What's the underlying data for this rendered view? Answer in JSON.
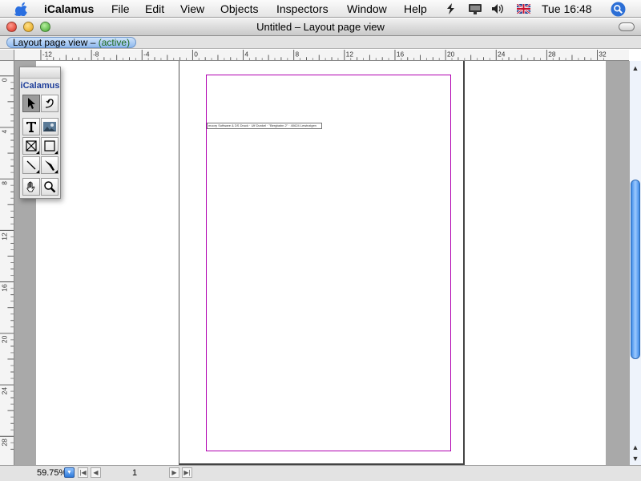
{
  "menubar": {
    "app_name": "iCalamus",
    "items": [
      "File",
      "Edit",
      "View",
      "Objects",
      "Inspectors",
      "Window",
      "Help"
    ],
    "clock": "Tue 16:48",
    "icons": [
      "apple-icon",
      "script-icon",
      "display-icon",
      "volume-icon",
      "uk-flag-icon",
      "spotlight-icon"
    ]
  },
  "window": {
    "title": "Untitled – Layout page view",
    "tab_label": "Layout page view –",
    "tab_status": "(active)"
  },
  "rulers": {
    "horizontal": [
      "12",
      "8",
      "4",
      "0",
      "4",
      "8",
      "12",
      "16",
      "20",
      "24",
      "28",
      "32"
    ],
    "vertical": [
      "0",
      "4",
      "8",
      "12",
      "16",
      "20",
      "24",
      "28"
    ]
  },
  "palette": {
    "title": "iCalamus",
    "tools": [
      "arrow-tool",
      "rotate-tool",
      "text-tool",
      "image-tool",
      "cross-frame-tool",
      "rectangle-tool",
      "line-tool",
      "pen-tool",
      "hand-tool",
      "zoom-tool"
    ]
  },
  "document": {
    "text_frame": "moory Software & DS Druck · Ulf Dunkel · \"Bergbahn 2\" · 40624 Lewinzigen"
  },
  "status": {
    "zoom": "59.75%",
    "page": "1"
  },
  "colors": {
    "margin_guide": "#b000b0",
    "selection_blue": "#3f8ce8"
  }
}
